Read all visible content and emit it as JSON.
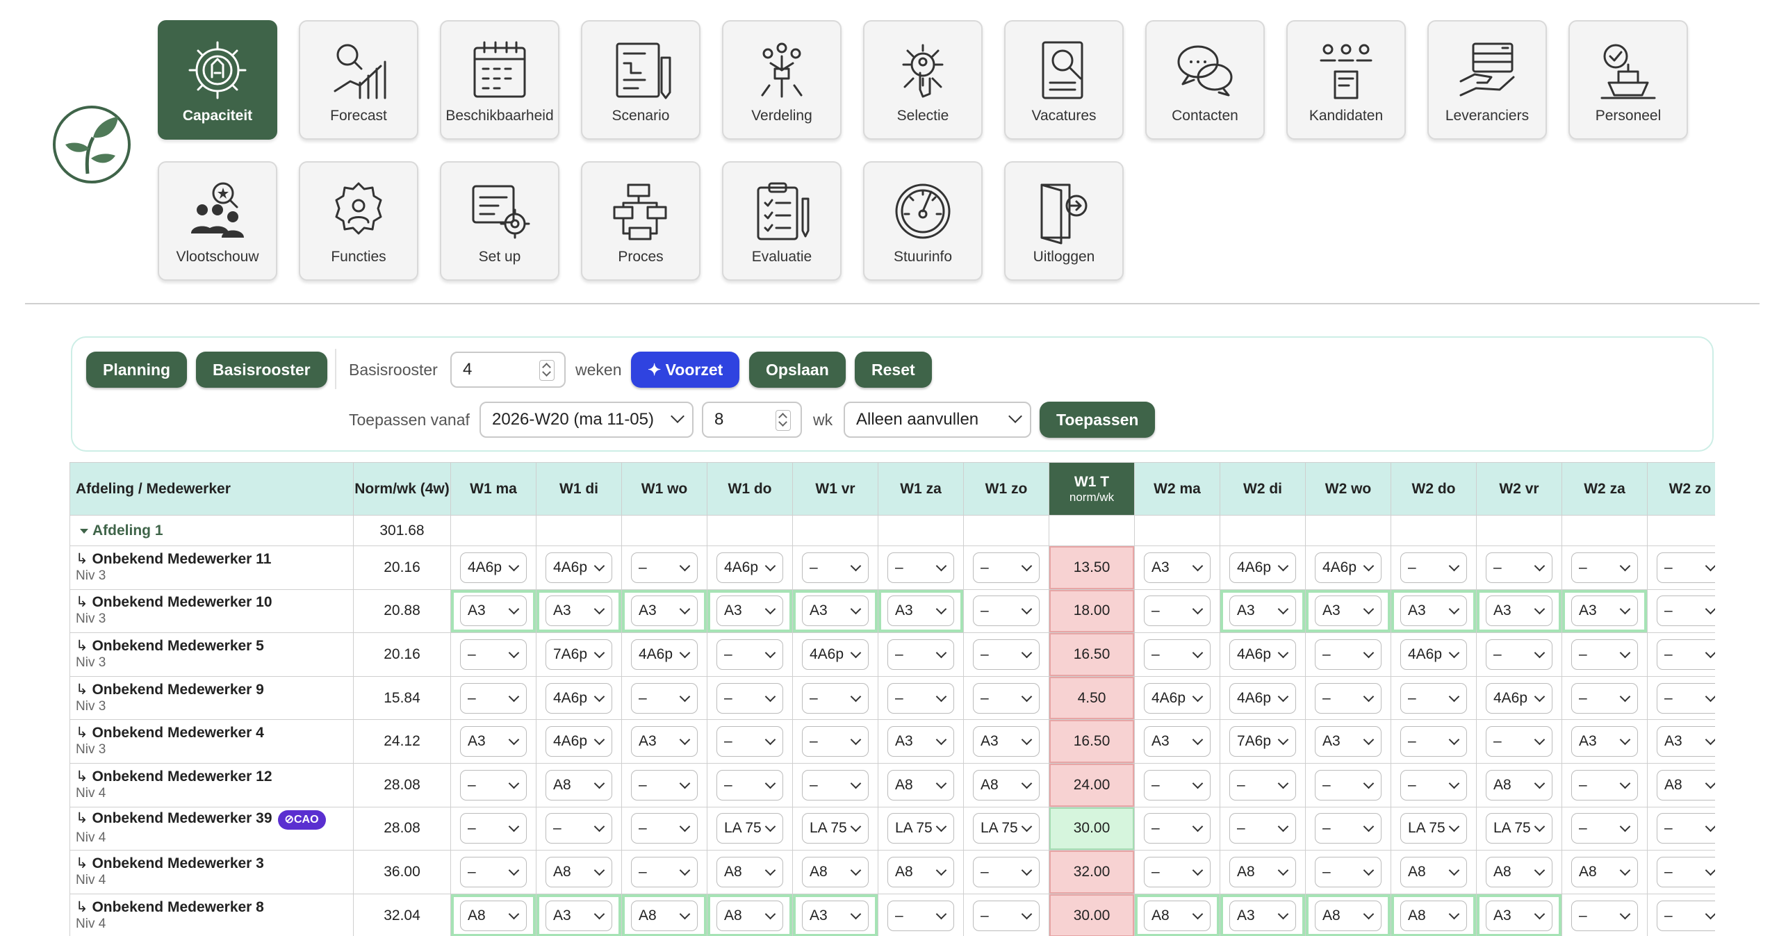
{
  "nav_tiles": [
    {
      "label": "Capaciteit",
      "icon": "capacity-icon",
      "active": true
    },
    {
      "label": "Forecast",
      "icon": "forecast-icon"
    },
    {
      "label": "Beschikbaarheid",
      "icon": "calendar-icon"
    },
    {
      "label": "Scenario",
      "icon": "scenario-icon"
    },
    {
      "label": "Verdeling",
      "icon": "distribution-icon"
    },
    {
      "label": "Selectie",
      "icon": "selection-icon"
    },
    {
      "label": "Vacatures",
      "icon": "vacancy-icon"
    },
    {
      "label": "Contacten",
      "icon": "chat-icon"
    },
    {
      "label": "Kandidaten",
      "icon": "candidates-icon"
    },
    {
      "label": "Leveranciers",
      "icon": "suppliers-icon"
    },
    {
      "label": "Personeel",
      "icon": "personnel-icon"
    },
    {
      "label": "Vlootschouw",
      "icon": "fleet-review-icon"
    },
    {
      "label": "Functies",
      "icon": "gear-person-icon"
    },
    {
      "label": "Set up",
      "icon": "setup-icon"
    },
    {
      "label": "Proces",
      "icon": "process-icon"
    },
    {
      "label": "Evaluatie",
      "icon": "clipboard-icon"
    },
    {
      "label": "Stuurinfo",
      "icon": "gauge-icon"
    },
    {
      "label": "Uitloggen",
      "icon": "logout-icon"
    }
  ],
  "toolbar": {
    "planning_label": "Planning",
    "basisrooster_label": "Basisrooster",
    "basisrooster_field_label": "Basisrooster",
    "weeks_value": "4",
    "weeks_label": "weken",
    "voorzet_label": "✦ Voorzet",
    "opslaan_label": "Opslaan",
    "reset_label": "Reset",
    "toepassen_vanaf_label": "Toepassen vanaf",
    "start_week_value": "2026-W20 (ma 11-05)",
    "wk_count_value": "8",
    "wk_label": "wk",
    "mode_value": "Alleen aanvullen",
    "toepassen_label": "Toepassen"
  },
  "table": {
    "col_name": "Afdeling / Medewerker",
    "col_norm": "Norm/wk (4w)",
    "day_cols_w1": [
      "W1 ma",
      "W1 di",
      "W1 wo",
      "W1 do",
      "W1 vr",
      "W1 za",
      "W1 zo"
    ],
    "total_col": {
      "label": "W1 T",
      "sub": "norm/wk"
    },
    "day_cols_w2": [
      "W2 ma",
      "W2 di",
      "W2 wo",
      "W2 do",
      "W2 vr",
      "W2 za",
      "W2 zo"
    ],
    "group": {
      "name": "Afdeling 1",
      "norm": "301.68"
    },
    "rows": [
      {
        "name": "Onbekend Medewerker 11",
        "level": "Niv 3",
        "norm": "20.16",
        "w1": [
          "4A6p",
          "4A6p",
          "–",
          "4A6p",
          "–",
          "–",
          "–"
        ],
        "total": "13.50",
        "status": "red",
        "w2": [
          "A3",
          "4A6p",
          "4A6p",
          "–",
          "–",
          "–",
          "–"
        ]
      },
      {
        "name": "Onbekend Medewerker 10",
        "level": "Niv 3",
        "norm": "20.88",
        "w1": [
          "A3",
          "A3",
          "A3",
          "A3",
          "A3",
          "A3",
          "–"
        ],
        "total": "18.00",
        "status": "red",
        "w2": [
          "–",
          "A3",
          "A3",
          "A3",
          "A3",
          "A3",
          "–"
        ]
      },
      {
        "name": "Onbekend Medewerker 5",
        "level": "Niv 3",
        "norm": "20.16",
        "w1": [
          "–",
          "7A6p",
          "4A6p",
          "–",
          "4A6p",
          "–",
          "–"
        ],
        "total": "16.50",
        "status": "red",
        "w2": [
          "–",
          "4A6p",
          "–",
          "4A6p",
          "–",
          "–",
          "–"
        ]
      },
      {
        "name": "Onbekend Medewerker 9",
        "level": "Niv 3",
        "norm": "15.84",
        "w1": [
          "–",
          "4A6p",
          "–",
          "–",
          "–",
          "–",
          "–"
        ],
        "total": "4.50",
        "status": "red",
        "w2": [
          "4A6p",
          "4A6p",
          "–",
          "–",
          "4A6p",
          "–",
          "–"
        ]
      },
      {
        "name": "Onbekend Medewerker 4",
        "level": "Niv 3",
        "norm": "24.12",
        "w1": [
          "A3",
          "4A6p",
          "A3",
          "–",
          "–",
          "A3",
          "A3"
        ],
        "total": "16.50",
        "status": "red",
        "w2": [
          "A3",
          "7A6p",
          "A3",
          "–",
          "–",
          "A3",
          "A3"
        ]
      },
      {
        "name": "Onbekend Medewerker 12",
        "level": "Niv 4",
        "norm": "28.08",
        "w1": [
          "–",
          "A8",
          "–",
          "–",
          "–",
          "A8",
          "A8"
        ],
        "total": "24.00",
        "status": "red",
        "w2": [
          "–",
          "–",
          "–",
          "–",
          "A8",
          "–",
          "A8"
        ]
      },
      {
        "name": "Onbekend Medewerker 39",
        "level": "Niv 4",
        "badge": "⊘CAO",
        "norm": "28.08",
        "w1": [
          "–",
          "–",
          "–",
          "LA 75",
          "LA 75",
          "LA 75",
          "LA 75"
        ],
        "total": "30.00",
        "status": "green",
        "w2": [
          "–",
          "–",
          "–",
          "LA 75",
          "LA 75",
          "–",
          "–"
        ]
      },
      {
        "name": "Onbekend Medewerker 3",
        "level": "Niv 4",
        "norm": "36.00",
        "w1": [
          "–",
          "A8",
          "–",
          "A8",
          "A8",
          "A8",
          "–"
        ],
        "total": "32.00",
        "status": "red",
        "w2": [
          "–",
          "A8",
          "–",
          "A8",
          "A8",
          "A8",
          "–"
        ]
      },
      {
        "name": "Onbekend Medewerker 8",
        "level": "Niv 4",
        "norm": "32.04",
        "w1": [
          "A8",
          "A3",
          "A8",
          "A8",
          "A3",
          "–",
          "–"
        ],
        "total": "30.00",
        "status": "red",
        "w2": [
          "A8",
          "A3",
          "A8",
          "A8",
          "A3",
          "–",
          "–"
        ]
      }
    ]
  },
  "colors": {
    "brand_green": "#3f6449",
    "voorzet_blue": "#2f43e0",
    "header_teal": "#cfeee9",
    "under_norm": "#f7d2d2",
    "over_norm": "#d6f5dd",
    "cao_badge": "#5a2fd0"
  }
}
